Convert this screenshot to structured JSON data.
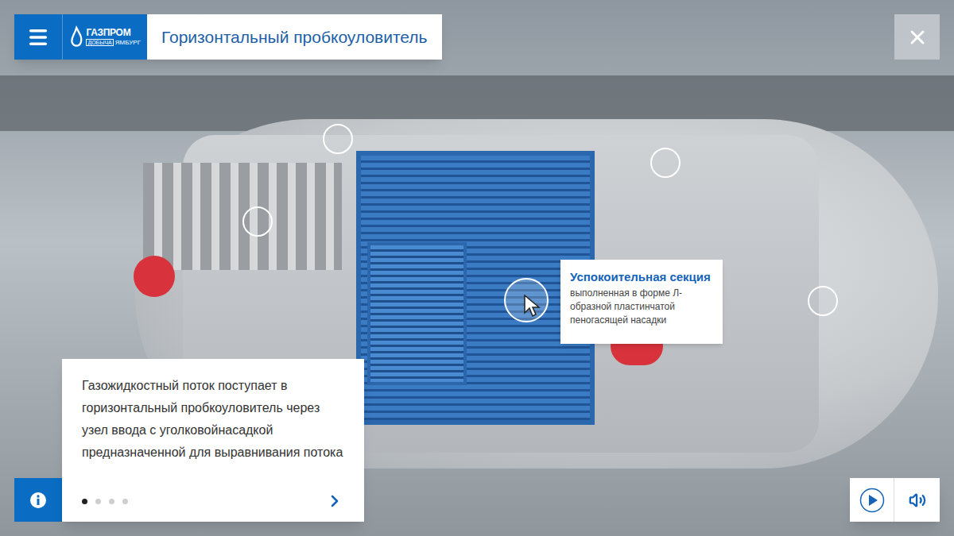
{
  "header": {
    "logo": {
      "name": "ГАЗПРОМ",
      "division": "добыча",
      "place": "ЯМБУРГ"
    },
    "title": "Горизонтальный пробкоуловитель"
  },
  "hotspots": [
    {
      "selected": false
    },
    {
      "selected": false
    },
    {
      "selected": false
    },
    {
      "selected": false
    },
    {
      "selected": true
    }
  ],
  "tooltip": {
    "title": "Успокоительная секция",
    "body": "выполненная в форме Л-образной пластинчатой пеногасящей насадки"
  },
  "info": {
    "text": "Газожидкостный поток поступает в горизонтальный пробкоуловитель через узел ввода с уголковойнасадкой предназначенной для выравнивания потока",
    "pages": [
      {
        "selected": true
      },
      {
        "selected": false
      },
      {
        "selected": false
      },
      {
        "selected": false
      }
    ]
  },
  "player": {
    "playing": false
  }
}
